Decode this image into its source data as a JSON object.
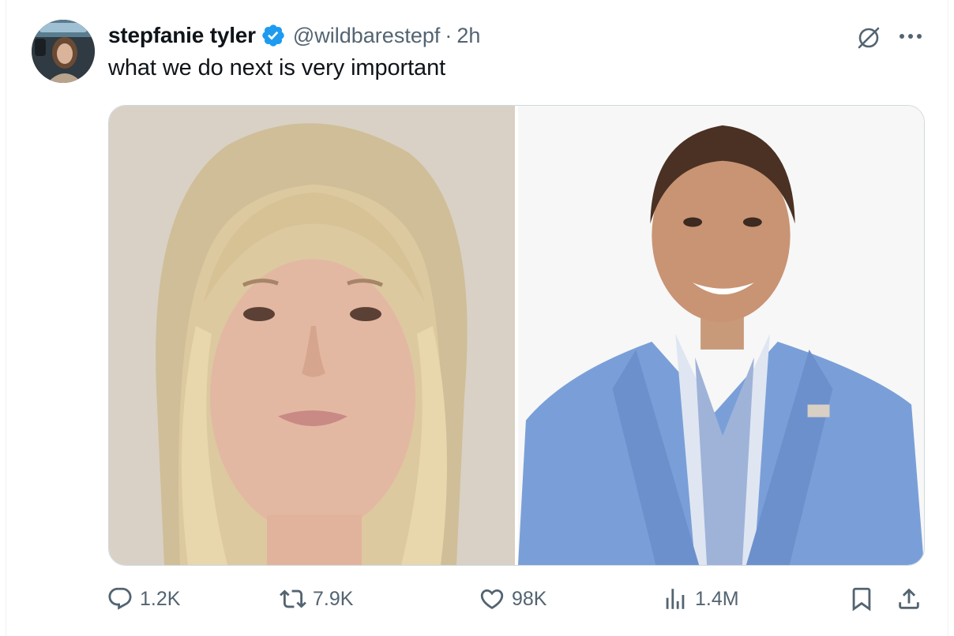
{
  "tweet": {
    "author": {
      "display_name": "stepfanie tyler",
      "handle": "@wildbarestepf",
      "verified": true,
      "time_separator": "·",
      "timestamp": "2h"
    },
    "text": "what we do next is very important",
    "media": [
      {
        "label": "photo-woman-blonde"
      },
      {
        "label": "photo-man-blue-blazer"
      }
    ],
    "actions": {
      "replies": "1.2K",
      "reposts": "7.9K",
      "likes": "98K",
      "views": "1.4M"
    },
    "icons": {
      "reply": "reply-icon",
      "repost": "repost-icon",
      "like": "heart-icon",
      "views": "views-icon",
      "bookmark": "bookmark-icon",
      "share": "share-icon",
      "grok": "grok-icon",
      "more": "more-icon",
      "verified": "verified-badge-icon"
    },
    "colors": {
      "text_primary": "#0f1419",
      "text_secondary": "#536471",
      "verified_blue": "#1d9bf0",
      "border": "#cfd9de"
    }
  }
}
